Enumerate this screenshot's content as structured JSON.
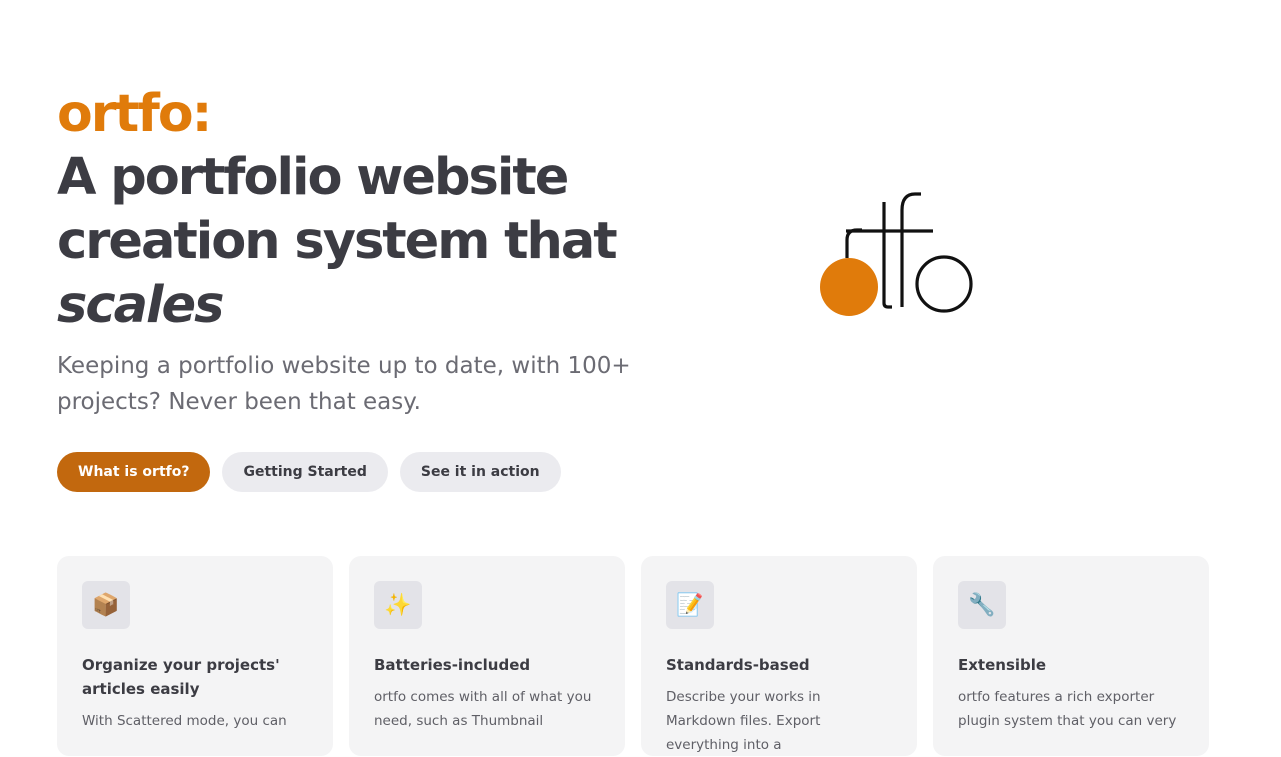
{
  "hero": {
    "name": "ortfo:",
    "text_line1": "A portfolio website",
    "text_line2": "creation system that",
    "text_emphasis": "scales",
    "tagline": "Keeping a portfolio website up to date, with 100+ projects? Never been that easy."
  },
  "actions": [
    {
      "label": "What is ortfo?",
      "theme": "brand"
    },
    {
      "label": "Getting Started",
      "theme": "alt"
    },
    {
      "label": "See it in action",
      "theme": "alt"
    }
  ],
  "features": [
    {
      "icon": "📦",
      "icon_name": "package-icon",
      "title": "Organize your projects' articles easily",
      "details": "With Scattered mode, you can"
    },
    {
      "icon": "✨",
      "icon_name": "sparkles-icon",
      "title": "Batteries-included",
      "details": "ortfo comes with all of what you need, such as Thumbnail"
    },
    {
      "icon": "📝",
      "icon_name": "memo-icon",
      "title": "Standards-based",
      "details": "Describe your works in Markdown files. Export everything into a"
    },
    {
      "icon": "🔧",
      "icon_name": "wrench-icon",
      "title": "Extensible",
      "details": "ortfo features a rich exporter plugin system that you can very"
    }
  ],
  "colors": {
    "brand": "#e07b0b",
    "brand_button": "#c2680e",
    "text": "#3c3c43"
  }
}
